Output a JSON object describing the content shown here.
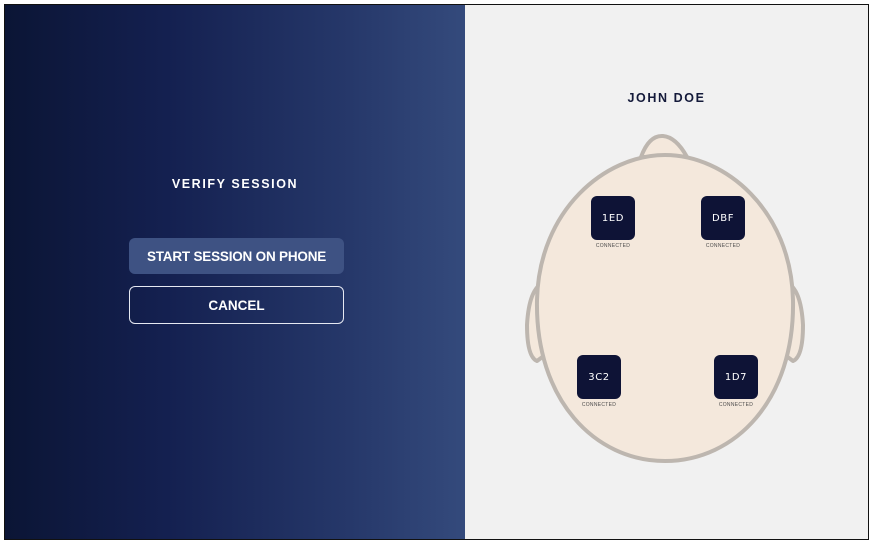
{
  "left_panel": {
    "title": "VERIFY SESSION",
    "start_button_label": "START SESSION ON PHONE",
    "cancel_button_label": "CANCEL"
  },
  "right_panel": {
    "user_name": "JOHN DOE",
    "sensors": [
      {
        "id": "1ED",
        "status": "CONNECTED"
      },
      {
        "id": "DBF",
        "status": "CONNECTED"
      },
      {
        "id": "3C2",
        "status": "CONNECTED"
      },
      {
        "id": "1D7",
        "status": "CONNECTED"
      }
    ]
  },
  "colors": {
    "left_gradient_start": "#0b1535",
    "left_gradient_end": "#344a7c",
    "start_button_bg": "#3e5283",
    "right_bg": "#f1f1f1",
    "head_fill": "#f4e8dc",
    "head_outline": "#bdb6af",
    "sensor_bg": "#0e1336"
  }
}
